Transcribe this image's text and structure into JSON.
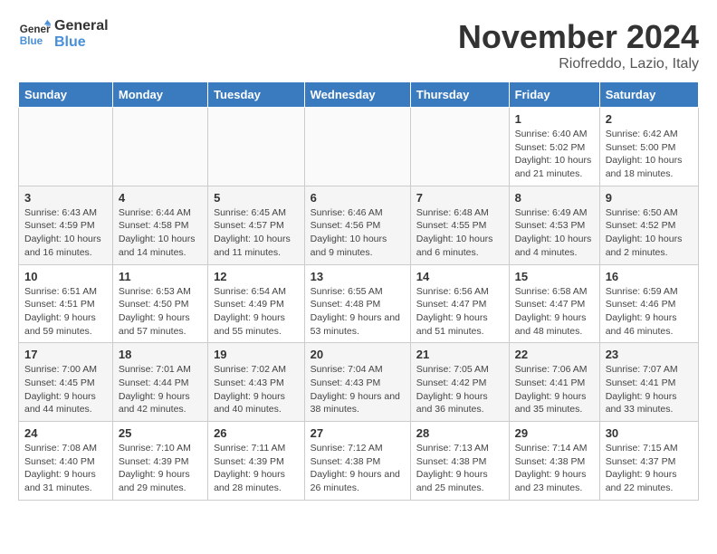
{
  "header": {
    "logo_line1": "General",
    "logo_line2": "Blue",
    "month": "November 2024",
    "location": "Riofreddo, Lazio, Italy"
  },
  "days_of_week": [
    "Sunday",
    "Monday",
    "Tuesday",
    "Wednesday",
    "Thursday",
    "Friday",
    "Saturday"
  ],
  "weeks": [
    [
      {
        "day": "",
        "info": ""
      },
      {
        "day": "",
        "info": ""
      },
      {
        "day": "",
        "info": ""
      },
      {
        "day": "",
        "info": ""
      },
      {
        "day": "",
        "info": ""
      },
      {
        "day": "1",
        "info": "Sunrise: 6:40 AM\nSunset: 5:02 PM\nDaylight: 10 hours and 21 minutes."
      },
      {
        "day": "2",
        "info": "Sunrise: 6:42 AM\nSunset: 5:00 PM\nDaylight: 10 hours and 18 minutes."
      }
    ],
    [
      {
        "day": "3",
        "info": "Sunrise: 6:43 AM\nSunset: 4:59 PM\nDaylight: 10 hours and 16 minutes."
      },
      {
        "day": "4",
        "info": "Sunrise: 6:44 AM\nSunset: 4:58 PM\nDaylight: 10 hours and 14 minutes."
      },
      {
        "day": "5",
        "info": "Sunrise: 6:45 AM\nSunset: 4:57 PM\nDaylight: 10 hours and 11 minutes."
      },
      {
        "day": "6",
        "info": "Sunrise: 6:46 AM\nSunset: 4:56 PM\nDaylight: 10 hours and 9 minutes."
      },
      {
        "day": "7",
        "info": "Sunrise: 6:48 AM\nSunset: 4:55 PM\nDaylight: 10 hours and 6 minutes."
      },
      {
        "day": "8",
        "info": "Sunrise: 6:49 AM\nSunset: 4:53 PM\nDaylight: 10 hours and 4 minutes."
      },
      {
        "day": "9",
        "info": "Sunrise: 6:50 AM\nSunset: 4:52 PM\nDaylight: 10 hours and 2 minutes."
      }
    ],
    [
      {
        "day": "10",
        "info": "Sunrise: 6:51 AM\nSunset: 4:51 PM\nDaylight: 9 hours and 59 minutes."
      },
      {
        "day": "11",
        "info": "Sunrise: 6:53 AM\nSunset: 4:50 PM\nDaylight: 9 hours and 57 minutes."
      },
      {
        "day": "12",
        "info": "Sunrise: 6:54 AM\nSunset: 4:49 PM\nDaylight: 9 hours and 55 minutes."
      },
      {
        "day": "13",
        "info": "Sunrise: 6:55 AM\nSunset: 4:48 PM\nDaylight: 9 hours and 53 minutes."
      },
      {
        "day": "14",
        "info": "Sunrise: 6:56 AM\nSunset: 4:47 PM\nDaylight: 9 hours and 51 minutes."
      },
      {
        "day": "15",
        "info": "Sunrise: 6:58 AM\nSunset: 4:47 PM\nDaylight: 9 hours and 48 minutes."
      },
      {
        "day": "16",
        "info": "Sunrise: 6:59 AM\nSunset: 4:46 PM\nDaylight: 9 hours and 46 minutes."
      }
    ],
    [
      {
        "day": "17",
        "info": "Sunrise: 7:00 AM\nSunset: 4:45 PM\nDaylight: 9 hours and 44 minutes."
      },
      {
        "day": "18",
        "info": "Sunrise: 7:01 AM\nSunset: 4:44 PM\nDaylight: 9 hours and 42 minutes."
      },
      {
        "day": "19",
        "info": "Sunrise: 7:02 AM\nSunset: 4:43 PM\nDaylight: 9 hours and 40 minutes."
      },
      {
        "day": "20",
        "info": "Sunrise: 7:04 AM\nSunset: 4:43 PM\nDaylight: 9 hours and 38 minutes."
      },
      {
        "day": "21",
        "info": "Sunrise: 7:05 AM\nSunset: 4:42 PM\nDaylight: 9 hours and 36 minutes."
      },
      {
        "day": "22",
        "info": "Sunrise: 7:06 AM\nSunset: 4:41 PM\nDaylight: 9 hours and 35 minutes."
      },
      {
        "day": "23",
        "info": "Sunrise: 7:07 AM\nSunset: 4:41 PM\nDaylight: 9 hours and 33 minutes."
      }
    ],
    [
      {
        "day": "24",
        "info": "Sunrise: 7:08 AM\nSunset: 4:40 PM\nDaylight: 9 hours and 31 minutes."
      },
      {
        "day": "25",
        "info": "Sunrise: 7:10 AM\nSunset: 4:39 PM\nDaylight: 9 hours and 29 minutes."
      },
      {
        "day": "26",
        "info": "Sunrise: 7:11 AM\nSunset: 4:39 PM\nDaylight: 9 hours and 28 minutes."
      },
      {
        "day": "27",
        "info": "Sunrise: 7:12 AM\nSunset: 4:38 PM\nDaylight: 9 hours and 26 minutes."
      },
      {
        "day": "28",
        "info": "Sunrise: 7:13 AM\nSunset: 4:38 PM\nDaylight: 9 hours and 25 minutes."
      },
      {
        "day": "29",
        "info": "Sunrise: 7:14 AM\nSunset: 4:38 PM\nDaylight: 9 hours and 23 minutes."
      },
      {
        "day": "30",
        "info": "Sunrise: 7:15 AM\nSunset: 4:37 PM\nDaylight: 9 hours and 22 minutes."
      }
    ]
  ]
}
